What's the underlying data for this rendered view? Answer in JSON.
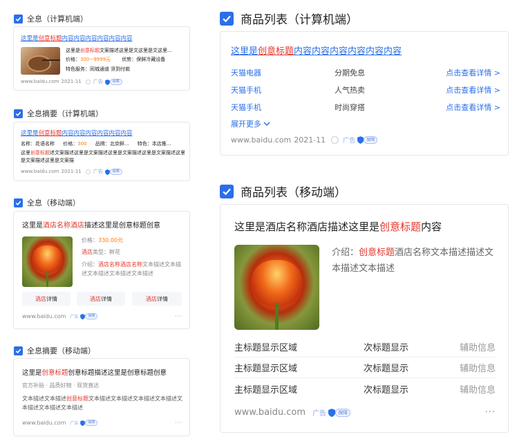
{
  "sections": {
    "s1": {
      "label": "全息（计算机端）"
    },
    "s2": {
      "label": "全息摘要（计算机端）"
    },
    "s3": {
      "label": "全息（移动端）"
    },
    "s4": {
      "label": "全息摘要（移动端）"
    },
    "s5": {
      "label": "商品列表（计算机端）"
    },
    "s6": {
      "label": "商品列表（移动端）"
    }
  },
  "card1": {
    "title_a": "这里是",
    "title_b": "创意标题",
    "title_c": "内容内容内容内容内容内容",
    "desc_a": "这里是",
    "desc_b": "创意标题",
    "desc_c": "文案描述这里是文这里是文这里...",
    "price_label": "价格：",
    "price": "300~9999元",
    "adv_label": "优势：",
    "adv": "保鲜冷藏设备",
    "service": "特色服务：同城通道 货到付款",
    "url": "www.baidu.com",
    "date": "2021-11",
    "ad": "广告",
    "badge": "保障"
  },
  "card2": {
    "title_a": "这里是",
    "title_b": "创意标题",
    "title_c": "内容内容内容内容内容内容",
    "meta_name": "名称：花语名称",
    "meta_price_label": "价格：",
    "meta_price": "300",
    "meta_brand": "品牌：北京鲜...",
    "meta_feature": "特色：本店推...",
    "desc_a": "这里",
    "desc_b": "创意标题",
    "desc_c": "述文案描述这里是文案描述这里是文案描述这里是文案描述这里是文案描述这里是文案描",
    "url": "www.baidu.com",
    "date": "2021-11",
    "ad": "广告",
    "badge": "保障"
  },
  "card3": {
    "title_a": "这里是",
    "title_b": "酒店名称酒店",
    "title_c": "描述这里是创意标题创意",
    "price_label": "价格：",
    "price": "330.00元",
    "type_a": "酒店",
    "type_b": "类型：",
    "type_c": "鲜花",
    "intro_label": "介绍：",
    "intro_b": "酒店名称酒店名称",
    "intro_c": "文本描述文本描述文本描述文本描述文本描述",
    "btn1_a": "酒店",
    "btn1_b": "详情",
    "btn2_a": "酒店",
    "btn2_b": "详情",
    "btn3_a": "酒店",
    "btn3_b": "详情",
    "url": "www.baidu.com",
    "ad": "广告",
    "badge": "保障",
    "more": "···"
  },
  "card4": {
    "title_a": "这里是",
    "title_b": "创意标题",
    "title_c": "创意标题描述这里是创意标题创意",
    "tags": "官方补贴 · 品质好物 · 现货直达",
    "desc_a": "文本描述文本描述",
    "desc_b": "创意标题",
    "desc_c": "文本描述文本描述文本描述文本描述文本描述文本描述文本描述",
    "url": "www.baidu.com",
    "ad": "广告",
    "badge": "保障",
    "more": "···"
  },
  "card5": {
    "title_a": "这里是",
    "title_b": "创意标题",
    "title_c": "内容内容内容内容内容内容",
    "rows": [
      {
        "name": "天猫电器",
        "tag": "分期免息",
        "link": "点击查看详情 >"
      },
      {
        "name": "天猫手机",
        "tag": "人气热卖",
        "link": "点击查看详情 >"
      },
      {
        "name": "天猫手机",
        "tag": "时尚穿搭",
        "link": "点击查看详情 >"
      }
    ],
    "expand": "展开更多",
    "url": "www.baidu.com",
    "date": "2021-11",
    "ad": "广告",
    "badge": "保障"
  },
  "card6": {
    "title_a": "这里是酒店名称酒店描述这里是",
    "title_b": "创意标题",
    "title_c": "内容",
    "intro_label": "介绍：",
    "intro_b": "创意标题",
    "intro_c": "酒店名称文本描述描述文本描述文本描述",
    "rows": [
      {
        "main": "主标题显示区域",
        "sub": "次标题显示",
        "aux": "辅助信息"
      },
      {
        "main": "主标题显示区域",
        "sub": "次标题显示",
        "aux": "辅助信息"
      },
      {
        "main": "主标题显示区域",
        "sub": "次标题显示",
        "aux": "辅助信息"
      }
    ],
    "url": "www.baidu.com",
    "ad": "广告",
    "badge": "保障",
    "more": "···"
  }
}
